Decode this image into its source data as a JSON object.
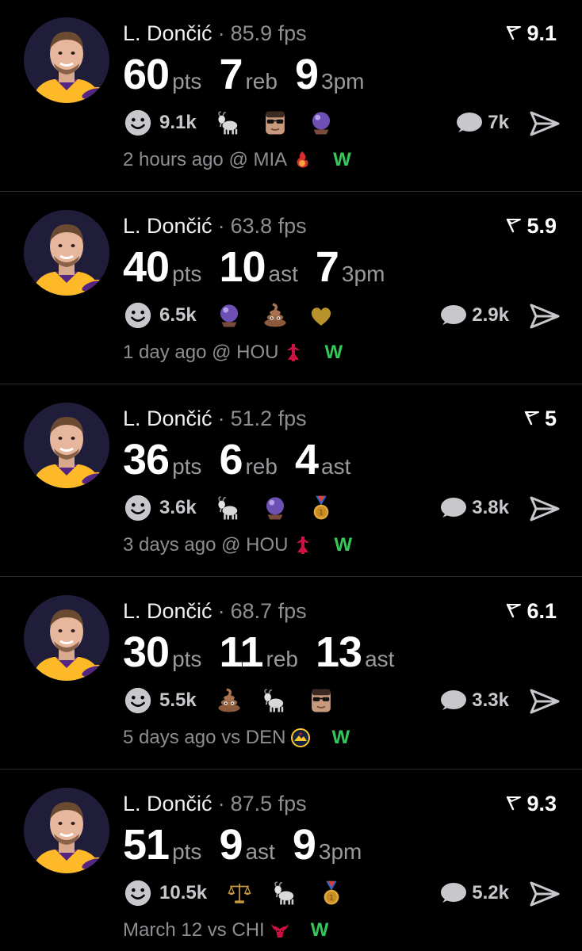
{
  "posts": [
    {
      "player": "L. Dončić",
      "separator": "·",
      "fps": "85.9 fps",
      "rating": "9.1",
      "stats": [
        {
          "value": "60",
          "unit": "pts"
        },
        {
          "value": "7",
          "unit": "reb"
        },
        {
          "value": "9",
          "unit": "3pm"
        }
      ],
      "smiley_count": "9.1k",
      "reactions": [
        "goat-emoji",
        "sunglasses-man-emoji",
        "crystal-ball-emoji"
      ],
      "comments": "7k",
      "time": "2 hours ago",
      "venue": "@ MIA",
      "team_icon": "heat-logo",
      "result": "W"
    },
    {
      "player": "L. Dončić",
      "separator": "·",
      "fps": "63.8 fps",
      "rating": "5.9",
      "stats": [
        {
          "value": "40",
          "unit": "pts"
        },
        {
          "value": "10",
          "unit": "ast"
        },
        {
          "value": "7",
          "unit": "3pm"
        }
      ],
      "smiley_count": "6.5k",
      "reactions": [
        "crystal-ball-emoji",
        "poop-emoji",
        "gold-heart-emoji"
      ],
      "comments": "2.9k",
      "time": "1 day ago",
      "venue": "@ HOU",
      "team_icon": "rockets-logo",
      "result": "W"
    },
    {
      "player": "L. Dončić",
      "separator": "·",
      "fps": "51.2 fps",
      "rating": "5",
      "stats": [
        {
          "value": "36",
          "unit": "pts"
        },
        {
          "value": "6",
          "unit": "reb"
        },
        {
          "value": "4",
          "unit": "ast"
        }
      ],
      "smiley_count": "3.6k",
      "reactions": [
        "goat-emoji",
        "crystal-ball-emoji",
        "gold-medal-emoji"
      ],
      "comments": "3.8k",
      "time": "3 days ago",
      "venue": "@ HOU",
      "team_icon": "rockets-logo",
      "result": "W"
    },
    {
      "player": "L. Dončić",
      "separator": "·",
      "fps": "68.7 fps",
      "rating": "6.1",
      "stats": [
        {
          "value": "30",
          "unit": "pts"
        },
        {
          "value": "11",
          "unit": "reb"
        },
        {
          "value": "13",
          "unit": "ast"
        }
      ],
      "smiley_count": "5.5k",
      "reactions": [
        "poop-emoji",
        "goat-emoji",
        "sunglasses-man-emoji"
      ],
      "comments": "3.3k",
      "time": "5 days ago",
      "venue": "vs DEN",
      "team_icon": "nuggets-logo",
      "result": "W"
    },
    {
      "player": "L. Dončić",
      "separator": "·",
      "fps": "87.5 fps",
      "rating": "9.3",
      "stats": [
        {
          "value": "51",
          "unit": "pts"
        },
        {
          "value": "9",
          "unit": "ast"
        },
        {
          "value": "9",
          "unit": "3pm"
        }
      ],
      "smiley_count": "10.5k",
      "reactions": [
        "scales-emoji",
        "goat-emoji",
        "gold-medal-emoji"
      ],
      "comments": "5.2k",
      "time": "March 12",
      "venue": "vs CHI",
      "team_icon": "bulls-logo",
      "result": "W"
    }
  ],
  "colors": {
    "background": "#000000",
    "muted_text": "#8e8e93",
    "win_green": "#34c759",
    "lakers_gold": "#fdb927",
    "lakers_purple": "#552583"
  }
}
